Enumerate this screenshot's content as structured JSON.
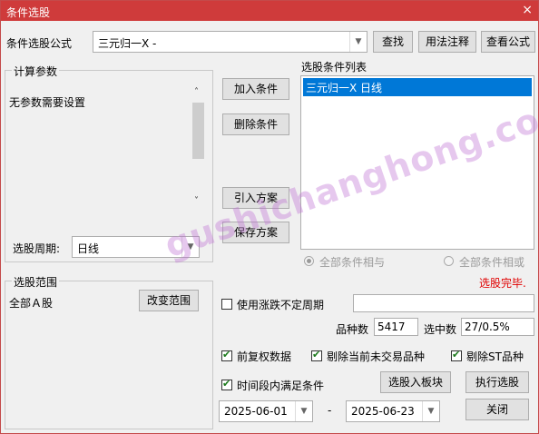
{
  "window": {
    "title": "条件选股",
    "close_glyph": "×"
  },
  "formula": {
    "label": "条件选股公式",
    "value": "三元归一X  -",
    "find_label": "查找",
    "usage_label": "用法注释",
    "view_label": "查看公式"
  },
  "params": {
    "group_label": "计算参数",
    "text": "无参数需要设置",
    "period_label": "选股周期:",
    "period_value": "日线"
  },
  "actions": {
    "add": "加入条件",
    "delete": "删除条件",
    "import": "引入方案",
    "save": "保存方案"
  },
  "conditions": {
    "label": "选股条件列表",
    "items": [
      "三元归一X  日线"
    ]
  },
  "logic": {
    "and_label": "全部条件相与",
    "or_label": "全部条件相或",
    "status": "选股完毕."
  },
  "scope": {
    "group_label": "选股范围",
    "value": "全部Ａ股",
    "change_label": "改变范围"
  },
  "options": {
    "variable_period_label": "使用涨跌不定周期",
    "count_label": "品种数",
    "count_value": "5417",
    "selected_label": "选中数",
    "selected_value": "27/0.5%",
    "prior_adjust_label": "前复权数据",
    "exclude_untraded_label": "剔除当前未交易品种",
    "exclude_st_label": "剔除ST品种",
    "time_range_label": "时间段内满足条件"
  },
  "dates": {
    "start": "2025-06-01",
    "separator": "-",
    "end": "2025-06-23"
  },
  "buttons": {
    "to_block": "选股入板块",
    "execute": "执行选股",
    "close": "关闭"
  },
  "watermark": "gushichanghong.com",
  "colors": {
    "title_bar": "#cf3b3b",
    "selection": "#0078d7",
    "status_red": "#e00000"
  }
}
